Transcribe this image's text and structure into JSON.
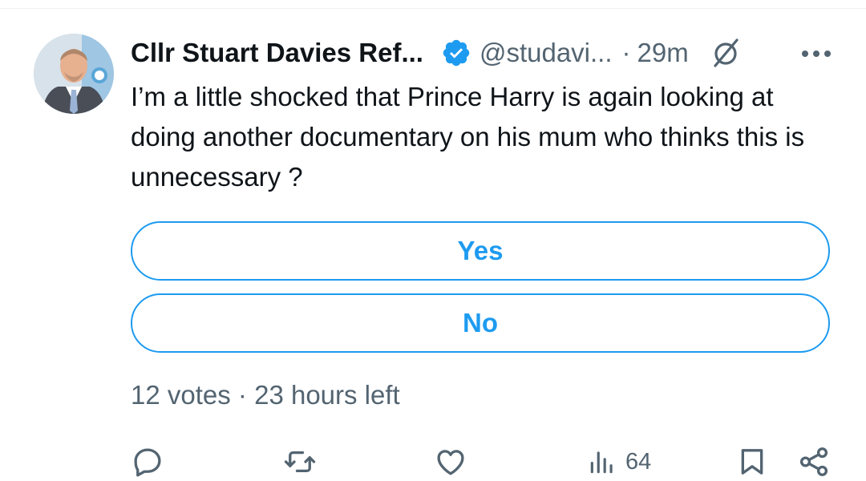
{
  "tweet": {
    "author_name": "Cllr Stuart Davies Ref...",
    "handle": "@studavi...",
    "separator": "·",
    "time": "29m",
    "text": "I’m a little shocked that Prince Harry is again looking at doing another documentary on his mum who thinks this is unnecessary ?"
  },
  "poll": {
    "options": [
      {
        "label": "Yes"
      },
      {
        "label": "No"
      }
    ],
    "votes": "12 votes",
    "separator": "·",
    "time_left": "23 hours left"
  },
  "actions": {
    "views": "64"
  },
  "colors": {
    "accent": "#1d9bf0",
    "text_primary": "#0f1419",
    "text_secondary": "#536471"
  },
  "icons": {
    "verified": "verified-badge-icon",
    "grok": "grok-icon",
    "more": "more-options-icon",
    "reply": "reply-icon",
    "retweet": "retweet-icon",
    "like": "like-icon",
    "views": "views-icon",
    "bookmark": "bookmark-icon",
    "share": "share-icon"
  }
}
